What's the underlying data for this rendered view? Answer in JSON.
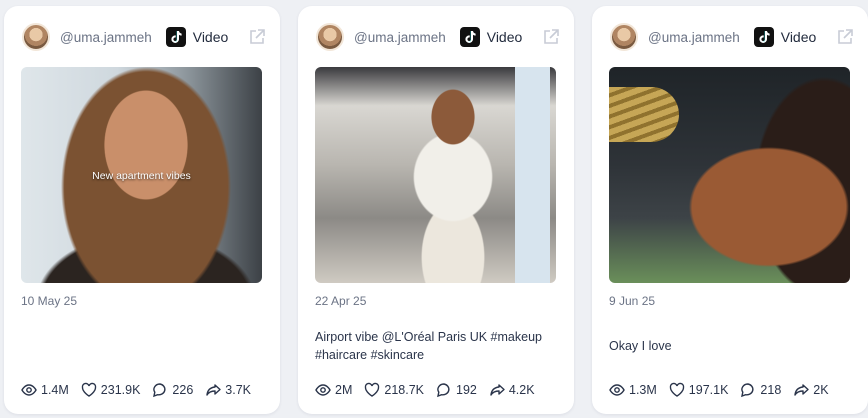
{
  "cards": [
    {
      "handle": "@uma.jammeh",
      "platform_icon": "tiktok-icon",
      "type": "Video",
      "overlay_text": "New apartment vibes",
      "date": "10 May 25",
      "caption": "",
      "stats": {
        "views": "1.4M",
        "likes": "231.9K",
        "comments": "226",
        "shares": "3.7K"
      }
    },
    {
      "handle": "@uma.jammeh",
      "platform_icon": "tiktok-icon",
      "type": "Video",
      "overlay_text": "",
      "date": "22 Apr 25",
      "caption": "Airport vibe @L'Oréal Paris UK #makeup #haircare #skincare",
      "stats": {
        "views": "2M",
        "likes": "218.7K",
        "comments": "192",
        "shares": "4.2K"
      }
    },
    {
      "handle": "@uma.jammeh",
      "platform_icon": "tiktok-icon",
      "type": "Video",
      "overlay_text": "",
      "date": "9 Jun 25",
      "caption": "Okay I love",
      "stats": {
        "views": "1.3M",
        "likes": "197.1K",
        "comments": "218",
        "shares": "2K"
      }
    }
  ],
  "colors": {
    "background": "#eef0f4",
    "card": "#ffffff",
    "muted_text": "#6b7385",
    "body_text": "#2a344a"
  }
}
